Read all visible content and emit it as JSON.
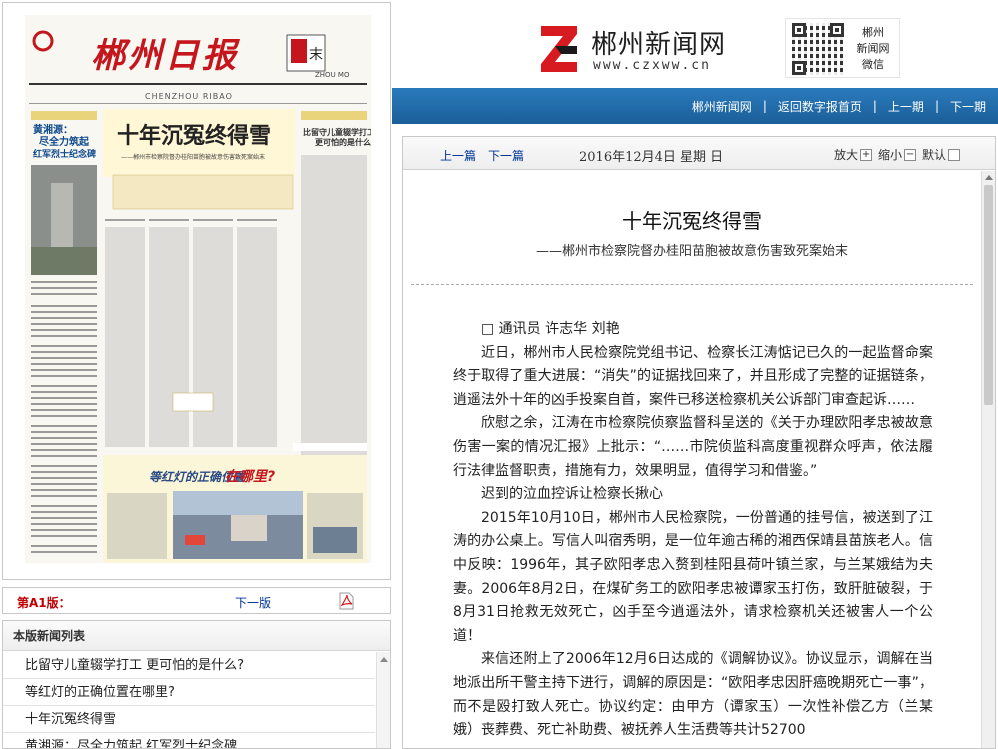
{
  "header": {
    "site_name": "郴州新闻网",
    "site_url": "www.czxww.cn",
    "wechat_label_1": "郴州",
    "wechat_label_2": "新闻网",
    "wechat_label_3": "微信"
  },
  "nav": {
    "items": [
      "郴州新闻网",
      "返回数字报首页",
      "上一期",
      "下一期"
    ]
  },
  "paper": {
    "masthead": "郴州日报",
    "weekend_tag": "周末",
    "weekend_en": "ZHOU MO",
    "pinyin": "CHENZHOU RIBAO",
    "left_headline_1": "黄湘源：",
    "left_headline_2": "尽全力筑起",
    "left_headline_3": "红军烈士纪念碑",
    "main_headline": "十年沉冤终得雪",
    "main_subhead": "——郴州市检察院督办桂阳苗胞被故意伤害致死案始末",
    "right_headline_1": "比留守儿童辍学打工",
    "right_headline_2": "更可怕的是什么?",
    "bottom_headline_1": "等红灯的正确位置",
    "bottom_headline_2": "在哪里?"
  },
  "page_nav": {
    "current_page": "第A1版：",
    "next_label": "下一版",
    "pdf_icon": "pdf-icon"
  },
  "news_list": {
    "title": "本版新闻列表",
    "items": [
      "比留守儿童辍学打工 更可怕的是什么?",
      "等红灯的正确位置在哪里?",
      "十年沉冤终得雪",
      "黄湘源：尽全力筑起 红军烈士纪念碑"
    ]
  },
  "toolbar": {
    "prev": "上一篇",
    "next": "下一篇",
    "date": "2016年12月4日 星期 日",
    "zoom_in": "放大",
    "zoom_out": "缩小",
    "default": "默认"
  },
  "article": {
    "title": "十年沉冤终得雪",
    "subtitle": "——郴州市检察院督办桂阳苗胞被故意伤害致死案始末",
    "byline": "□ 通讯员 许志华 刘艳",
    "paragraphs": [
      "近日，郴州市人民检察院党组书记、检察长江涛惦记已久的一起监督命案终于取得了重大进展：“消失”的证据找回来了，并且形成了完整的证据链条，逍遥法外十年的凶手投案自首，案件已移送检察机关公诉部门审查起诉……",
      "欣慰之余，江涛在市检察院侦察监督科呈送的《关于办理欧阳孝忠被故意伤害一案的情况汇报》上批示：“……市院侦监科高度重视群众呼声，依法履行法律监督职责，措施有力，效果明显，值得学习和借鉴。”",
      "迟到的泣血控诉让检察长揪心",
      "2015年10月10日，郴州市人民检察院，一份普通的挂号信，被送到了江涛的办公桌上。写信人叫宿秀明，是一位年逾古稀的湘西保靖县苗族老人。信中反映：1996年，其子欧阳孝忠入赘到桂阳县荷叶镇兰家，与兰某娥结为夫妻。2006年8月2日，在煤矿务工的欧阳孝忠被谭家玉打伤，致肝脏破裂，于8月31日抢救无效死亡，凶手至今逍遥法外，请求检察机关还被害人一个公道！",
      "来信还附上了2006年12月6日达成的《调解协议》。协议显示，调解在当地派出所干警主持下进行，调解的原因是：“欧阳孝忠因肝癌晚期死亡一事”，而不是殴打致人死亡。协议约定：由甲方（谭家玉）一次性补偿乙方（兰某娥）丧葬费、死亡补助费、被抚养人生活费等共计52700"
    ]
  },
  "colors": {
    "nav_blue": "#1f6aa8",
    "link_blue": "#003399",
    "page_red": "#c00000",
    "logo_red": "#d71920"
  }
}
